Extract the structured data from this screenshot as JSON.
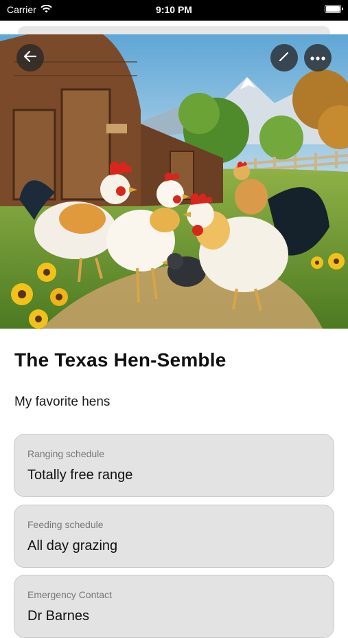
{
  "status_bar": {
    "carrier": "Carrier",
    "time": "9:10 PM"
  },
  "header": {
    "back_icon": "arrow-left-icon",
    "edit_icon": "pencil-icon",
    "more_icon": "ellipsis-icon"
  },
  "hero_image": {
    "subject": "hens"
  },
  "flock": {
    "name": "The Texas Hen-Semble",
    "description": "My favorite hens"
  },
  "details": [
    {
      "label": "Ranging schedule",
      "value": "Totally free range"
    },
    {
      "label": "Feeding schedule",
      "value": "All day grazing"
    },
    {
      "label": "Emergency Contact",
      "value": "Dr Barnes"
    }
  ]
}
